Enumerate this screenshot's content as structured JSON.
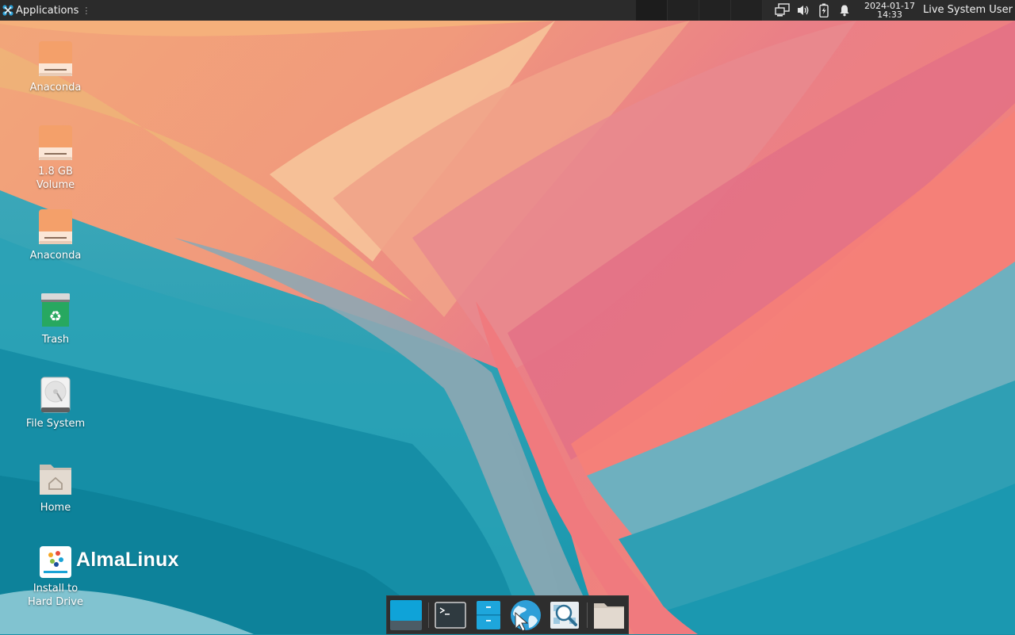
{
  "panel": {
    "apps_label": "Applications",
    "apps_separator": "⋮",
    "clock_date": "2024-01-17",
    "clock_time": "14:33",
    "user_label": "Live System User",
    "icons": [
      "network-icon",
      "volume-icon",
      "battery-icon",
      "notification-bell-icon"
    ]
  },
  "desktop": {
    "icons": [
      {
        "label": "Anaconda",
        "icon": "drive-icon"
      },
      {
        "label": "1.8 GB Volume",
        "icon": "drive-icon"
      },
      {
        "label": "Anaconda",
        "icon": "drive-icon"
      },
      {
        "label": "Trash",
        "icon": "trash-icon"
      },
      {
        "label": "File System",
        "icon": "harddisk-icon"
      },
      {
        "label": "Home",
        "icon": "home-folder-icon"
      },
      {
        "label": "Install to Hard Drive",
        "icon": "installer-icon"
      }
    ],
    "brand_text": "AlmaLinux"
  },
  "dock": {
    "items": [
      "show-desktop-icon",
      "terminal-icon",
      "file-manager-icon",
      "web-browser-icon",
      "app-finder-icon",
      "folder-icon"
    ]
  },
  "colors": {
    "panel_bg": "#2b2b2b",
    "drive_orange": "#f4a06a",
    "trash_green": "#27a860",
    "accent_blue": "#1aa3d6"
  }
}
